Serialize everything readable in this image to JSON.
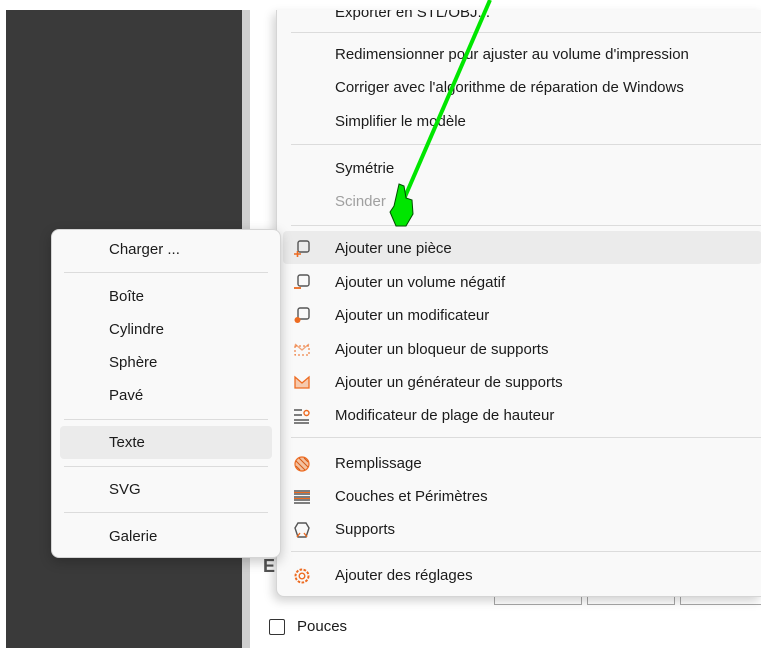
{
  "background": {
    "checkbox_label": "Pouces",
    "partial_letter": "E"
  },
  "main_menu": {
    "items": [
      {
        "label": "Exporter en STL/OBJ...",
        "enabled": true
      },
      {
        "label": "Redimensionner pour ajuster au volume d'impression",
        "enabled": true
      },
      {
        "label": "Corriger avec l'algorithme de réparation de Windows",
        "enabled": true
      },
      {
        "label": "Simplifier le modèle",
        "enabled": true
      },
      {
        "label": "Symétrie",
        "enabled": true
      },
      {
        "label": "Scinder",
        "enabled": false
      },
      {
        "label": "Ajouter une pièce",
        "enabled": true,
        "icon": "add-part-icon"
      },
      {
        "label": "Ajouter un volume négatif",
        "enabled": true,
        "icon": "negative-volume-icon"
      },
      {
        "label": "Ajouter un modificateur",
        "enabled": true,
        "icon": "modifier-icon"
      },
      {
        "label": "Ajouter un bloqueur de supports",
        "enabled": true,
        "icon": "support-blocker-icon"
      },
      {
        "label": "Ajouter un générateur de supports",
        "enabled": true,
        "icon": "support-enforcer-icon"
      },
      {
        "label": "Modificateur de plage de hauteur",
        "enabled": true,
        "icon": "height-range-icon"
      },
      {
        "label": "Remplissage",
        "enabled": true,
        "icon": "infill-icon"
      },
      {
        "label": "Couches et Périmètres",
        "enabled": true,
        "icon": "layers-icon"
      },
      {
        "label": "Supports",
        "enabled": true,
        "icon": "supports-icon"
      },
      {
        "label": "Ajouter des réglages",
        "enabled": true,
        "icon": "settings-icon"
      }
    ],
    "hovered": "Ajouter une pièce"
  },
  "sub_menu": {
    "items": [
      {
        "label": "Charger ..."
      },
      {
        "label": "Boîte"
      },
      {
        "label": "Cylindre"
      },
      {
        "label": "Sphère"
      },
      {
        "label": "Pavé"
      },
      {
        "label": "Texte"
      },
      {
        "label": "SVG"
      },
      {
        "label": "Galerie"
      }
    ],
    "hovered": "Texte"
  },
  "colors": {
    "accent_orange": "#ed6b21",
    "icon_gray": "#555555",
    "cursor_green": "#00e600"
  }
}
